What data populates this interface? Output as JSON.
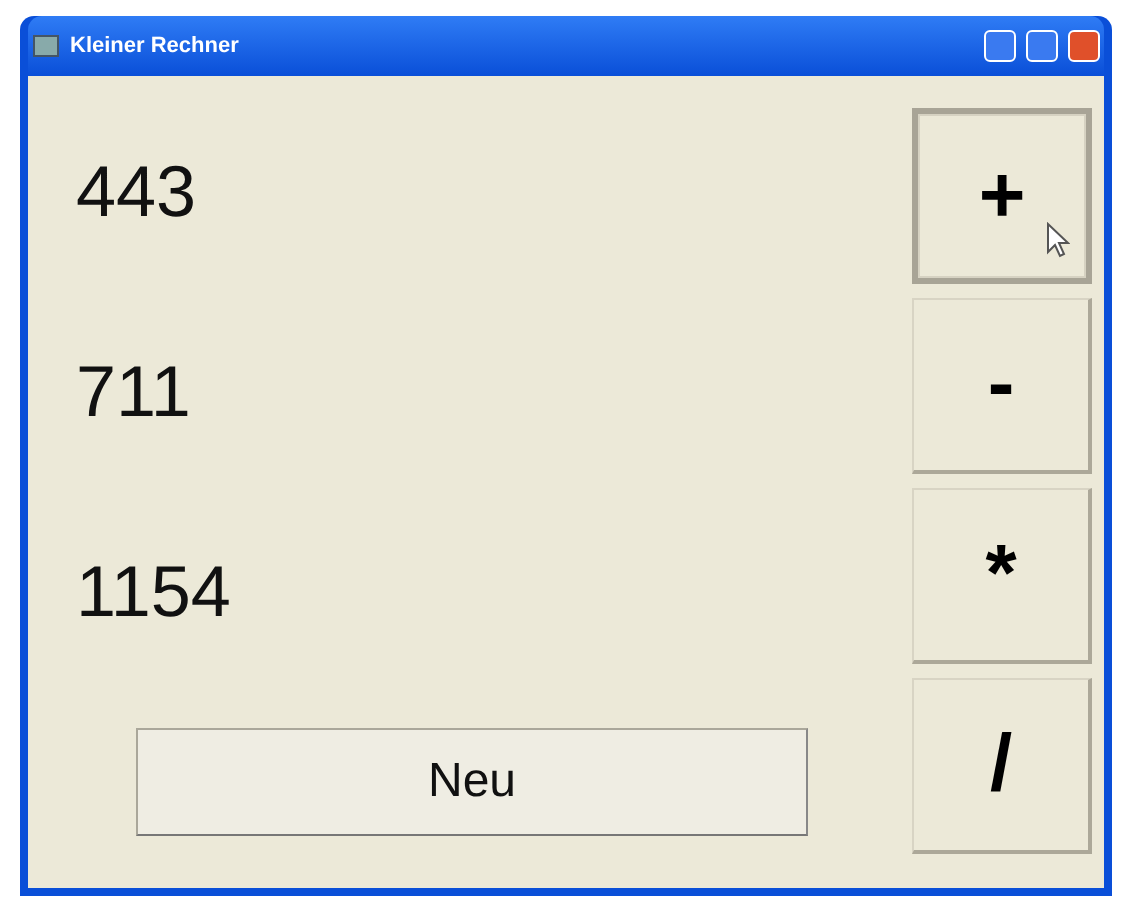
{
  "window": {
    "title": "Kleiner Rechner"
  },
  "values": [
    "443",
    "711",
    "1154"
  ],
  "new_button": {
    "label": "Neu"
  },
  "operators": [
    {
      "label": "+",
      "hovered": true
    },
    {
      "label": "-",
      "hovered": false
    },
    {
      "label": "*",
      "hovered": false
    },
    {
      "label": "/",
      "hovered": false
    }
  ]
}
